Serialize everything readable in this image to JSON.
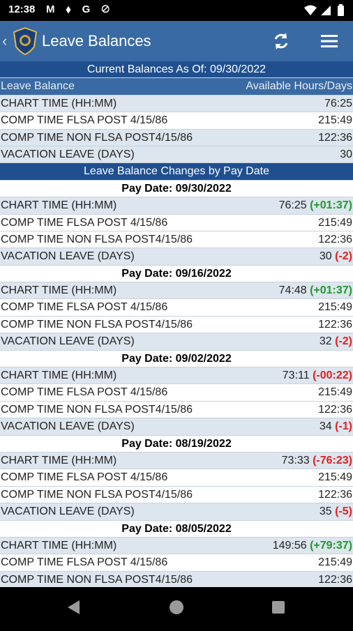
{
  "status_bar": {
    "time": "12:38",
    "icons": "M ⬧ G ⊘"
  },
  "app_bar": {
    "back": "‹",
    "title": "Leave Balances"
  },
  "current": {
    "header": "Current Balances As Of: 09/30/2022",
    "col_left": "Leave Balance",
    "col_right": "Available Hours/Days",
    "rows": [
      {
        "label": "CHART TIME (HH:MM)",
        "value": "76:25"
      },
      {
        "label": "COMP TIME FLSA POST 4/15/86",
        "value": "215:49"
      },
      {
        "label": "COMP TIME NON FLSA POST4/15/86",
        "value": "122:36"
      },
      {
        "label": "VACATION LEAVE (DAYS)",
        "value": "30"
      }
    ]
  },
  "changes": {
    "header": "Leave Balance Changes by Pay Date",
    "groups": [
      {
        "date": "Pay Date: 09/30/2022",
        "rows": [
          {
            "label": "CHART TIME (HH:MM)",
            "value": "76:25",
            "change": "(+01:37)",
            "sign": "pos"
          },
          {
            "label": "COMP TIME FLSA POST 4/15/86",
            "value": "215:49",
            "change": "",
            "sign": ""
          },
          {
            "label": "COMP TIME NON FLSA POST4/15/86",
            "value": "122:36",
            "change": "",
            "sign": ""
          },
          {
            "label": "VACATION LEAVE (DAYS)",
            "value": "30",
            "change": "(-2)",
            "sign": "neg"
          }
        ]
      },
      {
        "date": "Pay Date: 09/16/2022",
        "rows": [
          {
            "label": "CHART TIME (HH:MM)",
            "value": "74:48",
            "change": "(+01:37)",
            "sign": "pos"
          },
          {
            "label": "COMP TIME FLSA POST 4/15/86",
            "value": "215:49",
            "change": "",
            "sign": ""
          },
          {
            "label": "COMP TIME NON FLSA POST4/15/86",
            "value": "122:36",
            "change": "",
            "sign": ""
          },
          {
            "label": "VACATION LEAVE (DAYS)",
            "value": "32",
            "change": "(-2)",
            "sign": "neg"
          }
        ]
      },
      {
        "date": "Pay Date: 09/02/2022",
        "rows": [
          {
            "label": "CHART TIME (HH:MM)",
            "value": "73:11",
            "change": "(-00:22)",
            "sign": "neg"
          },
          {
            "label": "COMP TIME FLSA POST 4/15/86",
            "value": "215:49",
            "change": "",
            "sign": ""
          },
          {
            "label": "COMP TIME NON FLSA POST4/15/86",
            "value": "122:36",
            "change": "",
            "sign": ""
          },
          {
            "label": "VACATION LEAVE (DAYS)",
            "value": "34",
            "change": "(-1)",
            "sign": "neg"
          }
        ]
      },
      {
        "date": "Pay Date: 08/19/2022",
        "rows": [
          {
            "label": "CHART TIME (HH:MM)",
            "value": "73:33",
            "change": "(-76:23)",
            "sign": "neg"
          },
          {
            "label": "COMP TIME FLSA POST 4/15/86",
            "value": "215:49",
            "change": "",
            "sign": ""
          },
          {
            "label": "COMP TIME NON FLSA POST4/15/86",
            "value": "122:36",
            "change": "",
            "sign": ""
          },
          {
            "label": "VACATION LEAVE (DAYS)",
            "value": "35",
            "change": "(-5)",
            "sign": "neg"
          }
        ]
      },
      {
        "date": "Pay Date: 08/05/2022",
        "rows": [
          {
            "label": "CHART TIME (HH:MM)",
            "value": "149:56",
            "change": "(+79:37)",
            "sign": "pos"
          },
          {
            "label": "COMP TIME FLSA POST 4/15/86",
            "value": "215:49",
            "change": "",
            "sign": ""
          },
          {
            "label": "COMP TIME NON FLSA POST4/15/86",
            "value": "122:36",
            "change": "",
            "sign": ""
          }
        ]
      }
    ]
  },
  "colors": {
    "app_bar": "#3a6aa4",
    "header": "#1f4f8f",
    "row_alt": "#dde5ee",
    "positive": "#1e9a2a",
    "negative": "#e02020"
  },
  "icons": {
    "refresh": "refresh-icon",
    "menu": "menu-icon",
    "back": "back-arrow-icon",
    "badge": "badge-logo-icon"
  }
}
